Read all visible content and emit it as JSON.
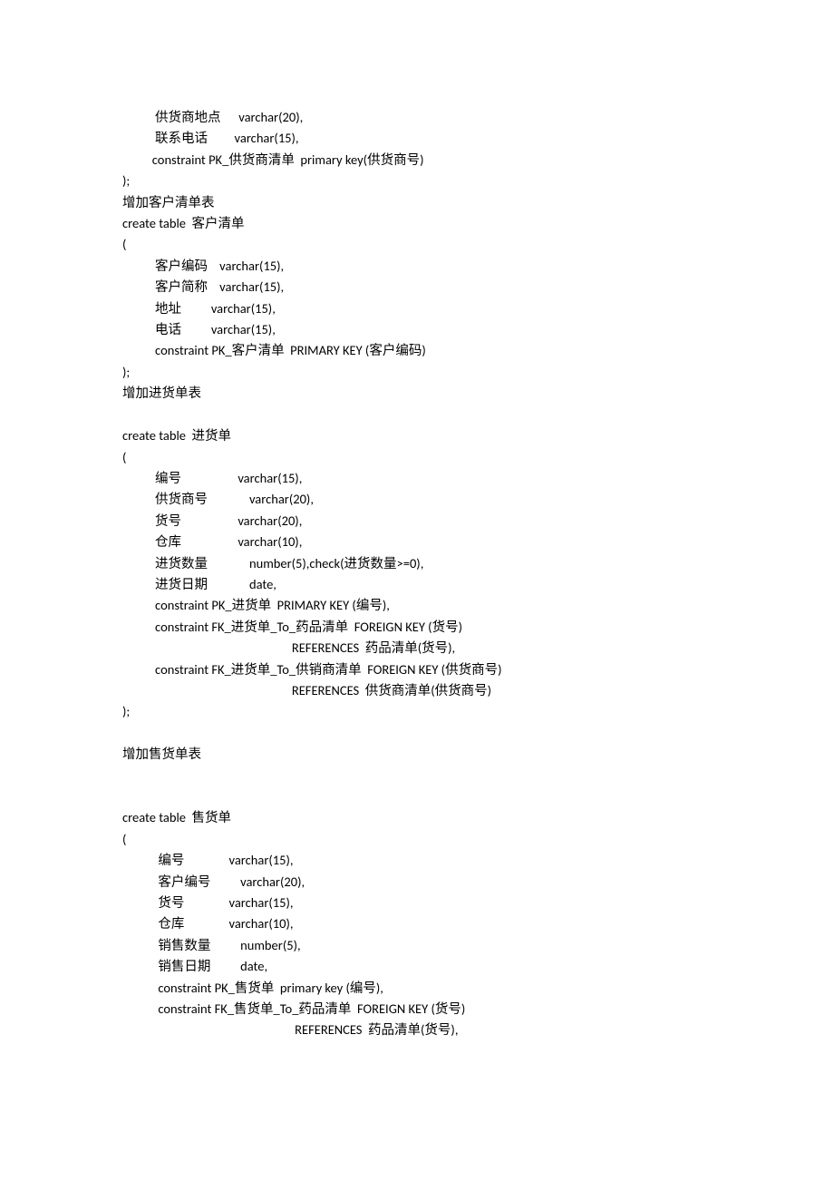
{
  "lines": [
    "           供货商地点      varchar(20),",
    "           联系电话         varchar(15),",
    "          constraint PK_供货商清单  primary key(供货商号)",
    ");",
    "增加客户清单表",
    "create table  客户清单",
    "(",
    "           客户编码    varchar(15),",
    "           客户简称    varchar(15),",
    "           地址          varchar(15),",
    "           电话          varchar(15),",
    "           constraint PK_客户清单  PRIMARY KEY (客户编码)",
    ");",
    "增加进货单表",
    "",
    "create table  进货单",
    "(",
    "           编号                   varchar(15),",
    "           供货商号              varchar(20),",
    "           货号                   varchar(20),",
    "           仓库                   varchar(10),",
    "           进货数量              number(5),check(进货数量>=0),",
    "           进货日期              date,",
    "           constraint PK_进货单  PRIMARY KEY (编号),",
    "           constraint FK_进货单_To_药品清单  FOREIGN KEY (货号)",
    "                                                         REFERENCES  药品清单(货号),",
    "           constraint FK_进货单_To_供销商清单  FOREIGN KEY (供货商号)",
    "                                                         REFERENCES  供货商清单(供货商号)",
    ");",
    "",
    "增加售货单表",
    "",
    "",
    "create table  售货单",
    "(",
    "            编号               varchar(15),",
    "            客户编号          varchar(20),",
    "            货号               varchar(15),",
    "            仓库               varchar(10),",
    "            销售数量          number(5),",
    "            销售日期          date,",
    "            constraint PK_售货单  primary key (编号),",
    "            constraint FK_售货单_To_药品清单  FOREIGN KEY (货号)",
    "                                                          REFERENCES  药品清单(货号),"
  ]
}
